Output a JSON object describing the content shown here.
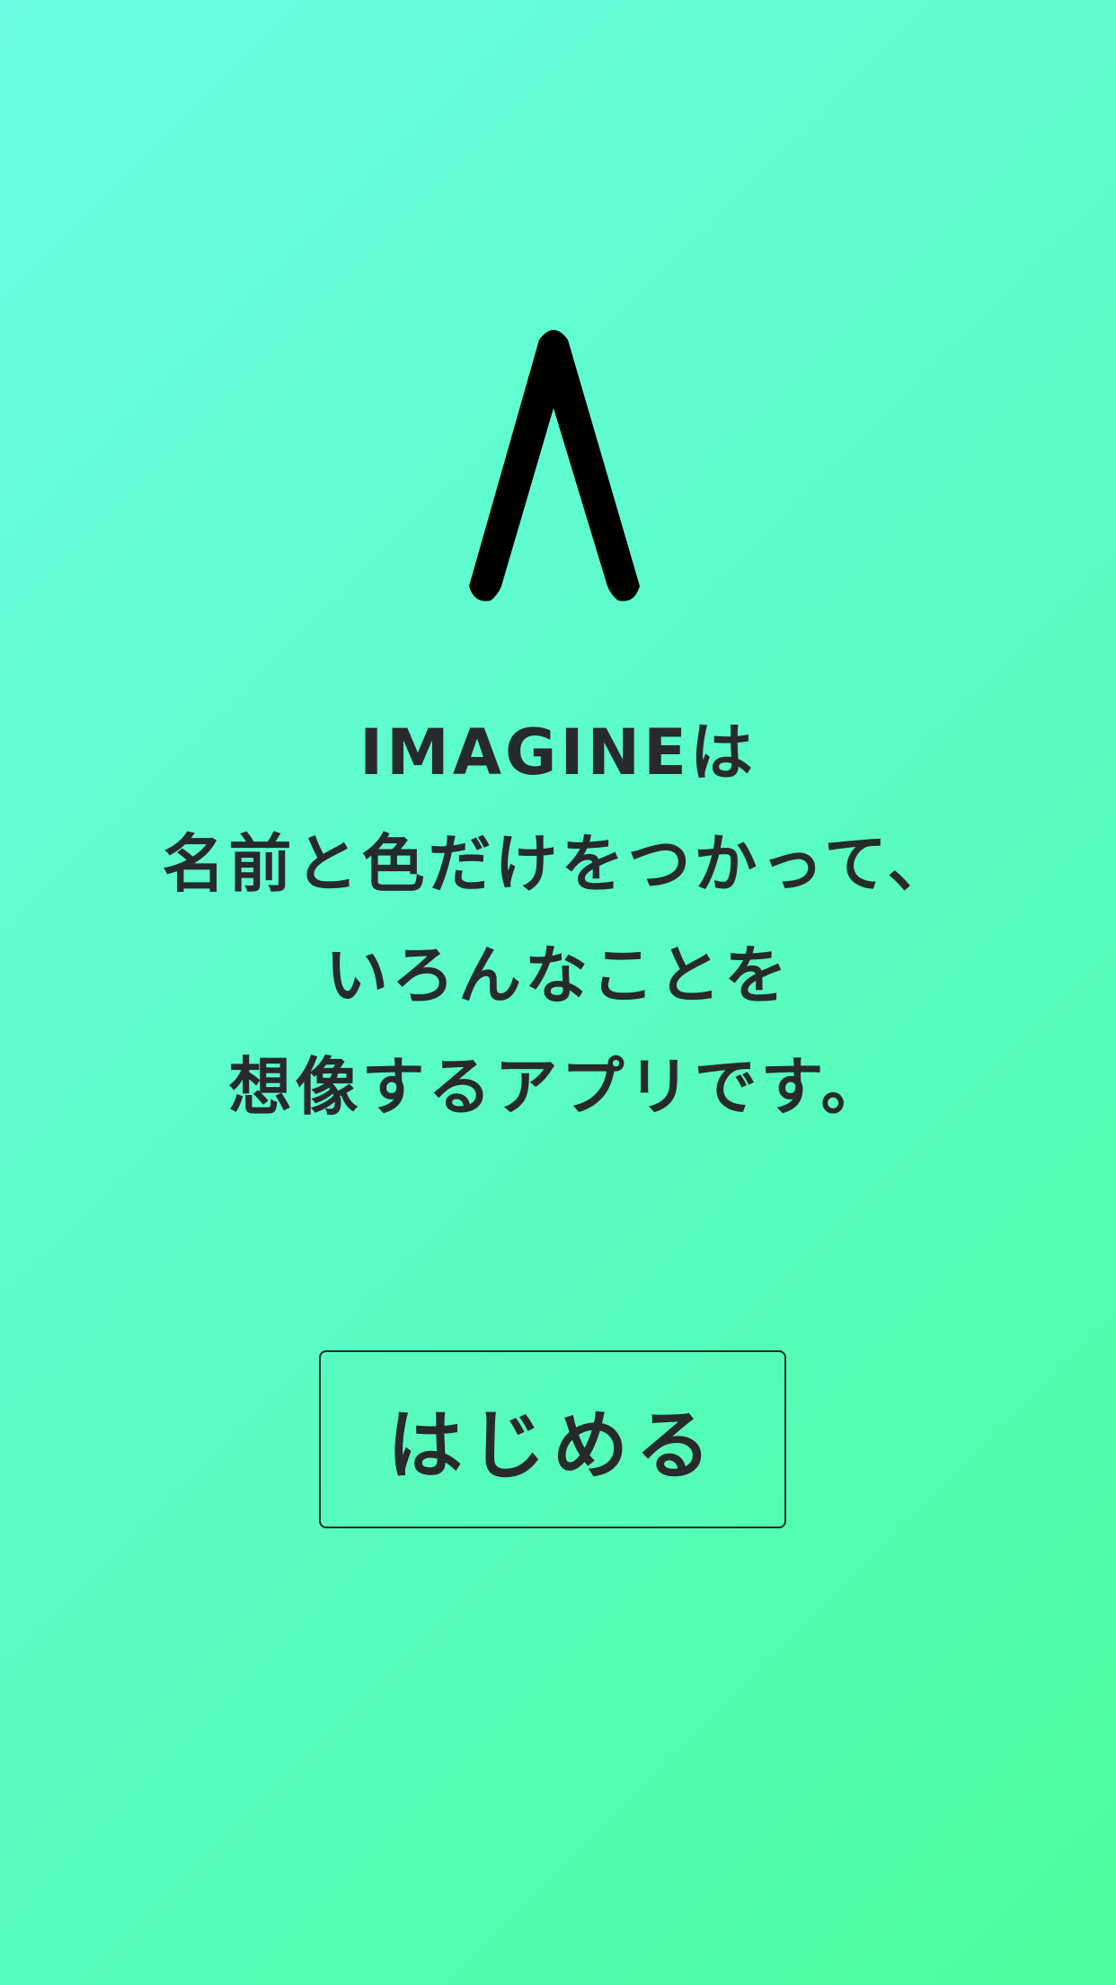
{
  "logo": {
    "icon": "lambda-logo-icon",
    "color": "#000000"
  },
  "description": {
    "lines": [
      "IMAGINEは",
      "名前と色だけをつかって、",
      "いろんなことを",
      "想像するアプリです。"
    ]
  },
  "start_button": {
    "label": "はじめる"
  },
  "colors": {
    "background_top_left": "#6afde3",
    "background_bottom_right": "#4dfd9f",
    "text": "#262a2b"
  }
}
